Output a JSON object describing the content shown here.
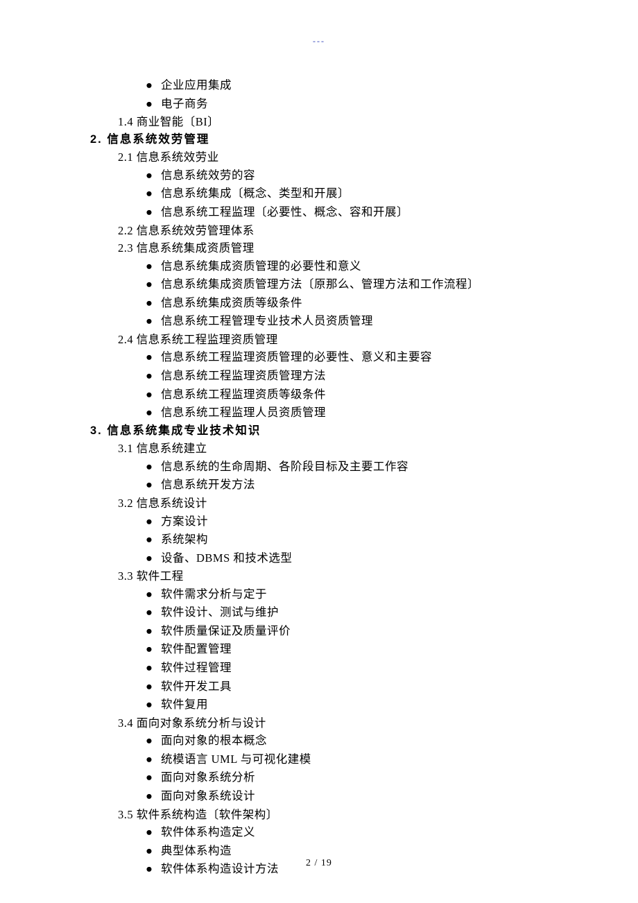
{
  "header_mark": "---",
  "footer": "2  /  19",
  "lines": [
    {
      "level": "l3",
      "bullet": true,
      "text": "企业应用集成"
    },
    {
      "level": "l3",
      "bullet": true,
      "text": "电子商务"
    },
    {
      "level": "l2",
      "bullet": false,
      "text": "1.4 商业智能〔BI〕"
    },
    {
      "level": "l1",
      "bullet": false,
      "text": "2. 信息系统效劳管理"
    },
    {
      "level": "l2",
      "bullet": false,
      "text": "2.1 信息系统效劳业"
    },
    {
      "level": "l3",
      "bullet": true,
      "text": "信息系统效劳的容"
    },
    {
      "level": "l3",
      "bullet": true,
      "text": "信息系统集成〔概念、类型和开展〕"
    },
    {
      "level": "l3",
      "bullet": true,
      "text": "信息系统工程监理〔必要性、概念、容和开展〕"
    },
    {
      "level": "l2",
      "bullet": false,
      "text": "2.2 信息系统效劳管理体系"
    },
    {
      "level": "l2",
      "bullet": false,
      "text": "2.3 信息系统集成资质管理"
    },
    {
      "level": "l3",
      "bullet": true,
      "text": "信息系统集成资质管理的必要性和意义"
    },
    {
      "level": "l3",
      "bullet": true,
      "text": "信息系统集成资质管理方法〔原那么、管理方法和工作流程〕"
    },
    {
      "level": "l3",
      "bullet": true,
      "text": "信息系统集成资质等级条件"
    },
    {
      "level": "l3",
      "bullet": true,
      "text": "信息系统工程管理专业技术人员资质管理"
    },
    {
      "level": "l2",
      "bullet": false,
      "text": "2.4 信息系统工程监理资质管理"
    },
    {
      "level": "l3",
      "bullet": true,
      "text": "信息系统工程监理资质管理的必要性、意义和主要容"
    },
    {
      "level": "l3",
      "bullet": true,
      "text": "信息系统工程监理资质管理方法"
    },
    {
      "level": "l3",
      "bullet": true,
      "text": "信息系统工程监理资质等级条件"
    },
    {
      "level": "l3",
      "bullet": true,
      "text": "信息系统工程监理人员资质管理"
    },
    {
      "level": "l1",
      "bullet": false,
      "text": "3. 信息系统集成专业技术知识"
    },
    {
      "level": "l2",
      "bullet": false,
      "text": "3.1 信息系统建立"
    },
    {
      "level": "l3",
      "bullet": true,
      "text": "信息系统的生命周期、各阶段目标及主要工作容"
    },
    {
      "level": "l3",
      "bullet": true,
      "text": "信息系统开发方法"
    },
    {
      "level": "l2",
      "bullet": false,
      "text": "3.2 信息系统设计"
    },
    {
      "level": "l3",
      "bullet": true,
      "text": "方案设计"
    },
    {
      "level": "l3",
      "bullet": true,
      "text": "系统架构"
    },
    {
      "level": "l3",
      "bullet": true,
      "text": "设备、DBMS 和技术选型"
    },
    {
      "level": "l2",
      "bullet": false,
      "text": "3.3 软件工程"
    },
    {
      "level": "l3",
      "bullet": true,
      "text": "软件需求分析与定于"
    },
    {
      "level": "l3",
      "bullet": true,
      "text": "软件设计、测试与维护"
    },
    {
      "level": "l3",
      "bullet": true,
      "text": "软件质量保证及质量评价"
    },
    {
      "level": "l3",
      "bullet": true,
      "text": "软件配置管理"
    },
    {
      "level": "l3",
      "bullet": true,
      "text": "软件过程管理"
    },
    {
      "level": "l3",
      "bullet": true,
      "text": "软件开发工具"
    },
    {
      "level": "l3",
      "bullet": true,
      "text": "软件复用"
    },
    {
      "level": "l2",
      "bullet": false,
      "text": "3.4 面向对象系统分析与设计"
    },
    {
      "level": "l3",
      "bullet": true,
      "text": "面向对象的根本概念"
    },
    {
      "level": "l3",
      "bullet": true,
      "text": "统模语言 UML 与可视化建模"
    },
    {
      "level": "l3",
      "bullet": true,
      "text": "面向对象系统分析"
    },
    {
      "level": "l3",
      "bullet": true,
      "text": "面向对象系统设计"
    },
    {
      "level": "l2",
      "bullet": false,
      "text": "3.5 软件系统构造〔软件架构〕"
    },
    {
      "level": "l3",
      "bullet": true,
      "text": "软件体系构造定义"
    },
    {
      "level": "l3",
      "bullet": true,
      "text": "典型体系构造"
    },
    {
      "level": "l3",
      "bullet": true,
      "text": "软件体系构造设计方法"
    }
  ]
}
